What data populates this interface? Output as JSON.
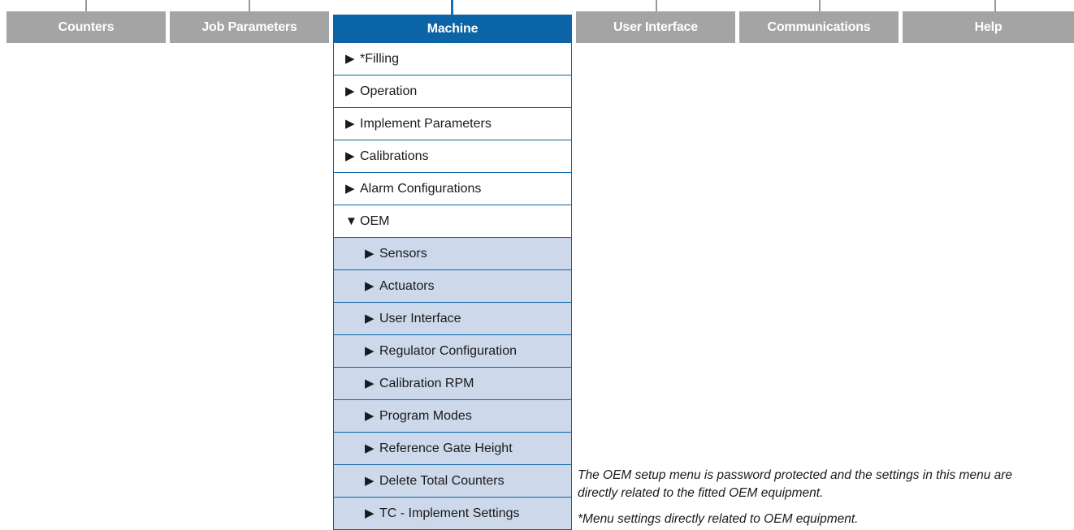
{
  "tabs": [
    {
      "label": "Counters"
    },
    {
      "label": "Job Parameters"
    },
    {
      "label": "Machine"
    },
    {
      "label": "User Interface"
    },
    {
      "label": "Communications"
    },
    {
      "label": "Help"
    }
  ],
  "active_tab": "Machine",
  "menu": {
    "items": [
      {
        "label": "*Filling",
        "arrow": "▶"
      },
      {
        "label": "Operation",
        "arrow": "▶"
      },
      {
        "label": "Implement Parameters",
        "arrow": "▶"
      },
      {
        "label": "Calibrations",
        "arrow": "▶"
      },
      {
        "label": "Alarm Configurations",
        "arrow": "▶"
      },
      {
        "label": "OEM",
        "arrow": "▼"
      }
    ],
    "oem_subitems": [
      {
        "label": "Sensors",
        "arrow": "▶"
      },
      {
        "label": "Actuators",
        "arrow": "▶"
      },
      {
        "label": "User Interface",
        "arrow": "▶"
      },
      {
        "label": "Regulator Configuration",
        "arrow": "▶"
      },
      {
        "label": "Calibration RPM",
        "arrow": "▶"
      },
      {
        "label": "Program Modes",
        "arrow": "▶"
      },
      {
        "label": "Reference Gate Height",
        "arrow": "▶"
      },
      {
        "label": "Delete Total Counters",
        "arrow": "▶"
      },
      {
        "label": "TC - Implement Settings",
        "arrow": "▶"
      }
    ]
  },
  "notes": {
    "line1": "The OEM setup menu is password protected and the settings in this menu are",
    "line2": "directly related to the fitted OEM equipment.",
    "footnote": "*Menu settings directly related to OEM equipment."
  },
  "colors": {
    "tab_inactive": "#a4a4a4",
    "tab_active": "#0b63a8",
    "submenu_bg": "#cdd8ea",
    "menu_border": "#0b63a8"
  }
}
